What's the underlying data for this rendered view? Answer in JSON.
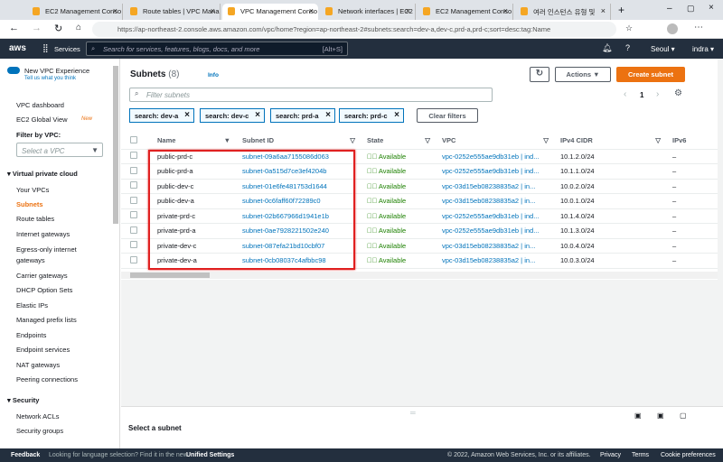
{
  "browser": {
    "tabs": [
      "EC2 Management Conso",
      "Route tables | VPC Mana",
      "VPC Management Conso",
      "Network interfaces | EC2",
      "EC2 Management Conso",
      "여러 인스턴스 유형 및"
    ],
    "url": "https://ap-northeast-2.console.aws.amazon.com/vpc/home?region=ap-northeast-2#subnets:search=dev-a,dev-c,prd-a,prd-c;sort=desc:tag:Name"
  },
  "awsnav": {
    "logo": "aws",
    "services": "Services",
    "search_placeholder": "Search for services, features, blogs, docs, and more",
    "shortcut": "[Alt+S]",
    "region": "Seoul ▾",
    "user": "indra ▾"
  },
  "sidebar": {
    "new_vpc": "New VPC Experience",
    "tell_us": "Tell us what you think",
    "dashboard": "VPC dashboard",
    "ec2_global": "EC2 Global View",
    "new_badge": "New",
    "filter_label": "Filter by VPC:",
    "select_placeholder": "Select a VPC",
    "vpc_section": "Virtual private cloud",
    "items": [
      "Your VPCs",
      "Subnets",
      "Route tables",
      "Internet gateways",
      "Egress-only internet",
      "gateways",
      "Carrier gateways",
      "DHCP Option Sets",
      "Elastic IPs",
      "Managed prefix lists",
      "Endpoints",
      "Endpoint services",
      "NAT gateways",
      "Peering connections"
    ],
    "security_section": "Security",
    "security_items": [
      "Network ACLs",
      "Security groups"
    ]
  },
  "main": {
    "title": "Subnets",
    "count": "(8)",
    "info": "Info",
    "actions": "Actions ▼",
    "create": "Create subnet",
    "filter_placeholder": "Filter subnets",
    "page": "1",
    "chips": [
      "search: dev-a",
      "search: dev-c",
      "search: prd-a",
      "search: prd-c"
    ],
    "clear": "Clear filters",
    "columns": [
      "Name",
      "Subnet ID",
      "State",
      "VPC",
      "IPv4 CIDR",
      "IPv6"
    ],
    "rows": [
      [
        "public-prd-c",
        "subnet-09a6aa7155086d063",
        "Available",
        "vpc-0252e555ae9db31eb | ind...",
        "10.1.2.0/24",
        "–"
      ],
      [
        "public-prd-a",
        "subnet-0a515d7ce3ef4204b",
        "Available",
        "vpc-0252e555ae9db31eb | ind...",
        "10.1.1.0/24",
        "–"
      ],
      [
        "public-dev-c",
        "subnet-01e6fe481753d1644",
        "Available",
        "vpc-03d15eb08238835a2 | in...",
        "10.0.2.0/24",
        "–"
      ],
      [
        "public-dev-a",
        "subnet-0c6faff60f72289c0",
        "Available",
        "vpc-03d15eb08238835a2 | in...",
        "10.0.1.0/24",
        "–"
      ],
      [
        "private-prd-c",
        "subnet-02b667966d1941e1b",
        "Available",
        "vpc-0252e555ae9db31eb | ind...",
        "10.1.4.0/24",
        "–"
      ],
      [
        "private-prd-a",
        "subnet-0ae7928221502e240",
        "Available",
        "vpc-0252e555ae9db31eb | ind...",
        "10.1.3.0/24",
        "–"
      ],
      [
        "private-dev-c",
        "subnet-087efa21bd10cbf07",
        "Available",
        "vpc-03d15eb08238835a2 | in...",
        "10.0.4.0/24",
        "–"
      ],
      [
        "private-dev-a",
        "subnet-0cb08037c4afbbc98",
        "Available",
        "vpc-03d15eb08238835a2 | in...",
        "10.0.3.0/24",
        "–"
      ]
    ],
    "select_subnet": "Select a subnet"
  },
  "footer": {
    "feedback": "Feedback",
    "lang": "Looking for language selection? Find it in the new",
    "unified": "Unified Settings",
    "copyright": "© 2022, Amazon Web Services, Inc. or its affiliates.",
    "privacy": "Privacy",
    "terms": "Terms",
    "cookies": "Cookie preferences"
  },
  "colors": {
    "accent": "#ec7211",
    "link": "#0073bb",
    "highlight": "#e02020"
  }
}
